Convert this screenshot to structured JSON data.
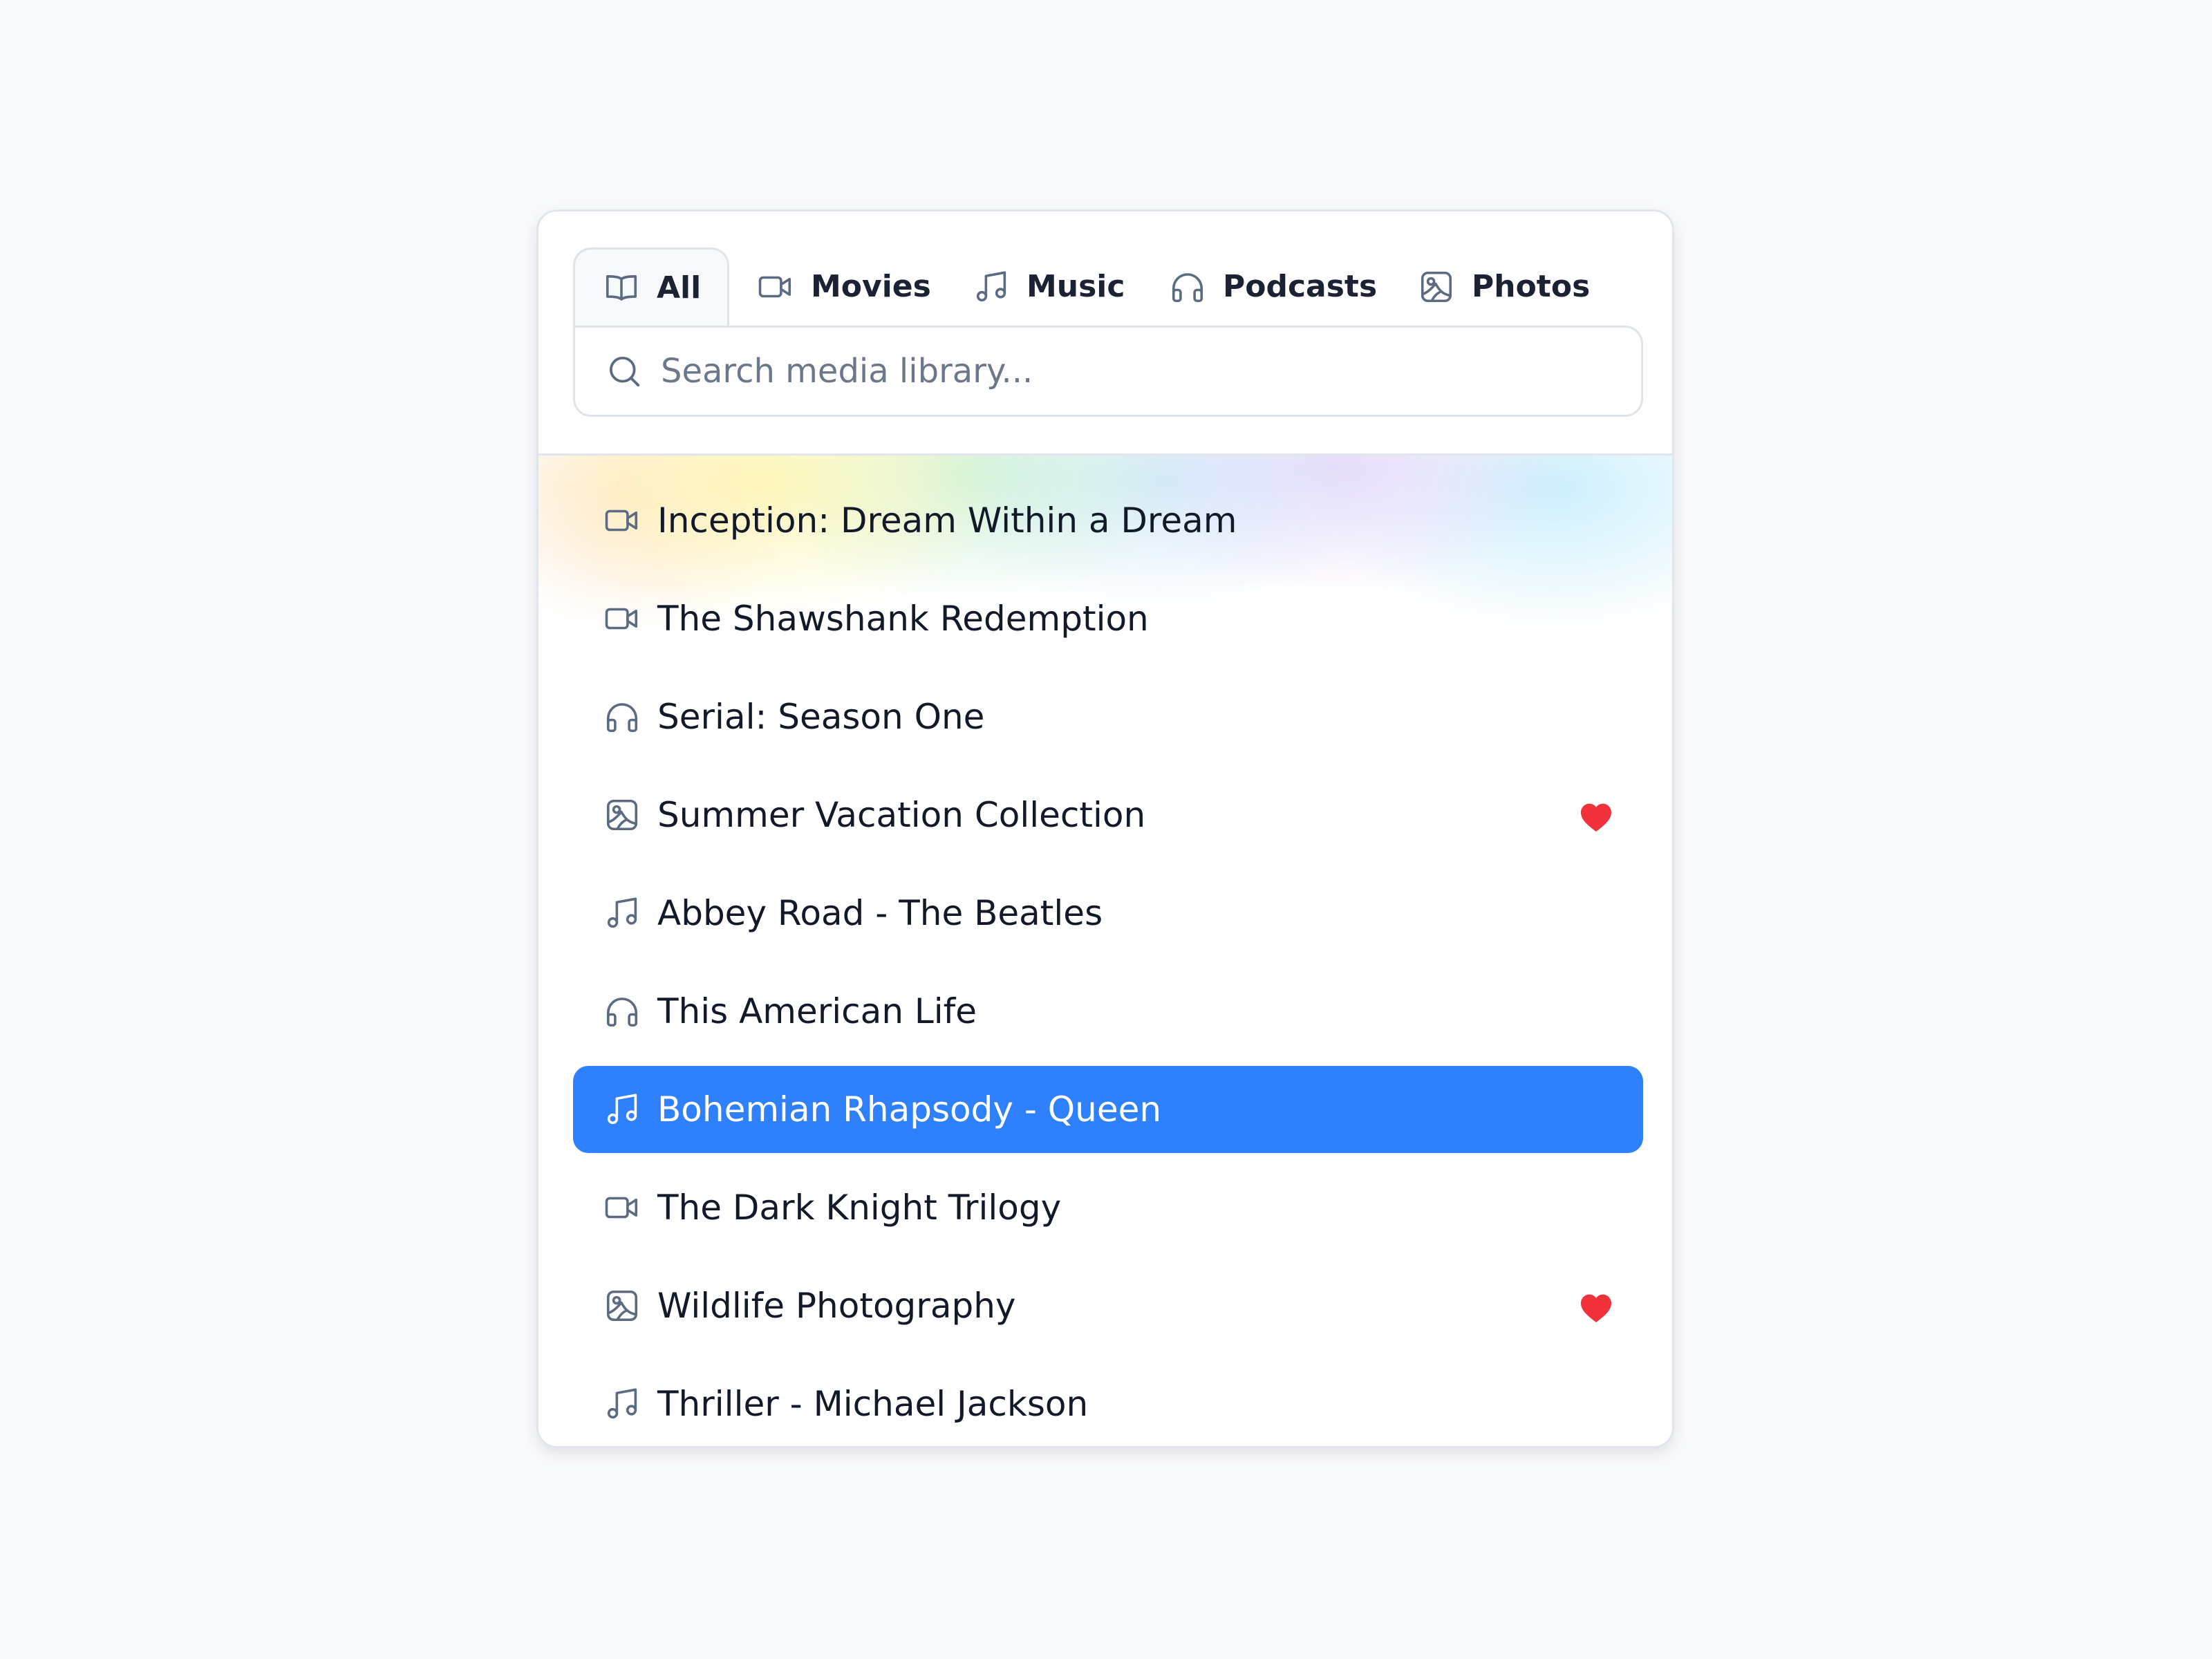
{
  "tabs": [
    {
      "label": "All",
      "icon": "book-icon",
      "active": true
    },
    {
      "label": "Movies",
      "icon": "video-camera-icon",
      "active": false
    },
    {
      "label": "Music",
      "icon": "music-note-icon",
      "active": false
    },
    {
      "label": "Podcasts",
      "icon": "headphones-icon",
      "active": false
    },
    {
      "label": "Photos",
      "icon": "image-icon",
      "active": false
    }
  ],
  "search": {
    "placeholder": "Search media library...",
    "value": "",
    "icon": "search-icon"
  },
  "items": [
    {
      "title": "Inception: Dream Within a Dream",
      "icon": "video-camera-icon",
      "favorite": false,
      "selected": false
    },
    {
      "title": "The Shawshank Redemption",
      "icon": "video-camera-icon",
      "favorite": false,
      "selected": false
    },
    {
      "title": "Serial: Season One",
      "icon": "headphones-icon",
      "favorite": false,
      "selected": false
    },
    {
      "title": "Summer Vacation Collection",
      "icon": "image-icon",
      "favorite": true,
      "selected": false
    },
    {
      "title": "Abbey Road - The Beatles",
      "icon": "music-note-icon",
      "favorite": false,
      "selected": false
    },
    {
      "title": "This American Life",
      "icon": "headphones-icon",
      "favorite": false,
      "selected": false
    },
    {
      "title": "Bohemian Rhapsody - Queen",
      "icon": "music-note-icon",
      "favorite": false,
      "selected": true
    },
    {
      "title": "The Dark Knight Trilogy",
      "icon": "video-camera-icon",
      "favorite": false,
      "selected": false
    },
    {
      "title": "Wildlife Photography",
      "icon": "image-icon",
      "favorite": true,
      "selected": false
    },
    {
      "title": "Thriller - Michael Jackson",
      "icon": "music-note-icon",
      "favorite": false,
      "selected": false
    }
  ],
  "colors": {
    "accent": "#2f80fc",
    "favorite": "#f2323a",
    "icon": "#5b6b82",
    "text": "#121a2a",
    "background": "#f8f9fb"
  }
}
